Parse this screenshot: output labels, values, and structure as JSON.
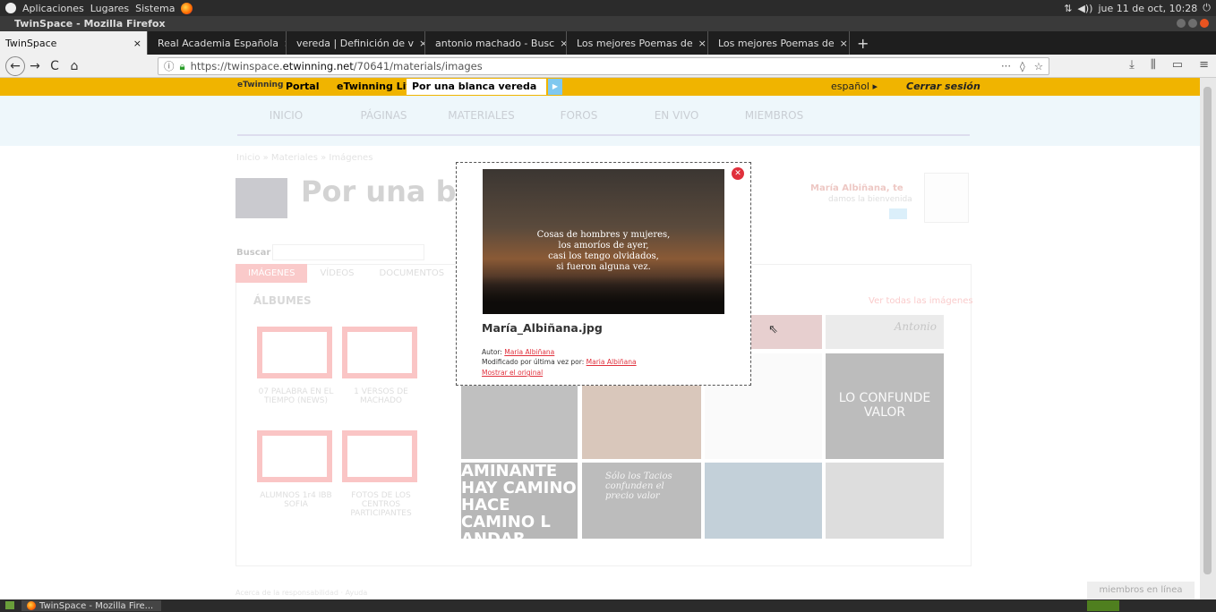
{
  "os": {
    "menu": [
      "Aplicaciones",
      "Lugares",
      "Sistema"
    ],
    "clock": "jue 11 de oct, 10:28"
  },
  "window": {
    "title": "TwinSpace - Mozilla Firefox"
  },
  "tabs": [
    {
      "label": "TwinSpace",
      "active": true,
      "close": "×",
      "color": "#f0f0f0"
    },
    {
      "label": "Real Academia Española",
      "close": "×",
      "color": "#2d4fa3"
    },
    {
      "label": "vereda | Definición de v",
      "close": "×",
      "color": "#2d4fa3"
    },
    {
      "label": "antonio machado - Busc",
      "close": "×",
      "color": "#4285f4"
    },
    {
      "label": "Los mejores Poemas de",
      "close": "×",
      "color": "#e31b23"
    },
    {
      "label": "Los mejores Poemas de",
      "close": "×",
      "color": "#e31b23"
    }
  ],
  "new_tab": "+",
  "nav": {
    "url_prefix": "https://twinspace.",
    "url_domain": "etwinning.net",
    "url_path": "/70641/materials/images",
    "url_more": "···",
    "back": "←",
    "forward": "→",
    "reload": "C",
    "home": "⌂"
  },
  "etwinning_bar": {
    "logo": "eTwinning",
    "portal": "Portal",
    "live": "eTwinning Live",
    "selected_project": "Por una blanca vereda",
    "language": "español ▸",
    "logout": "Cerrar sesión"
  },
  "main_menu": [
    "INICIO",
    "PÁGINAS",
    "MATERIALES",
    "FOROS",
    "EN VIVO",
    "MIEMBROS"
  ],
  "breadcrumb": "Inicio » Materiales » Imágenes",
  "page_title": "Por una blanc",
  "user": {
    "name": "María Albiñana,",
    "greeting_suffix": "te",
    "welcome": "damos la bienvenida"
  },
  "search": {
    "label": "Buscar"
  },
  "content_tabs": [
    "IMÁGENES",
    "VÍDEOS",
    "DOCUMENTOS"
  ],
  "albums": {
    "title": "ÁLBUMES",
    "view_all": "Ver todas las imágenes",
    "items": [
      {
        "label": "07 PALABRA EN EL TIEMPO (NEWS)"
      },
      {
        "label": "1 VERSOS DE MACHADO"
      },
      {
        "label": "ALUMNOS 1r4 IBB SOFIA"
      },
      {
        "label": "FOTOS DE LOS CENTROS PARTICIPANTES"
      }
    ]
  },
  "gallery_text": {
    "antonio": "Antonio",
    "confunde": "LO CONFUNDE VALOR",
    "caminante": "AMINANTE HAY CAMINO HACE CAMINO L ANDAR",
    "solo": "Sólo los Tacios confunden el precio valor"
  },
  "modal": {
    "poem": [
      "Cosas de hombres y mujeres,",
      "los amoríos de ayer,",
      "casi los tengo olvidados,",
      "si fueron alguna vez."
    ],
    "filename": "María_Albiñana.jpg",
    "author_label": "Autor:",
    "author": "Maria Albiñana",
    "modified_label": "Modificado por última vez por:",
    "modified_by": "Maria Albiñana",
    "show_original": "Mostrar el original",
    "close": "✕",
    "prev": "❮",
    "next": "❯"
  },
  "footer": {
    "text": "Acerca de la responsabilidad · Ayuda"
  },
  "members_online": "miembros en línea",
  "taskbar": {
    "task": "TwinSpace - Mozilla Fire..."
  }
}
